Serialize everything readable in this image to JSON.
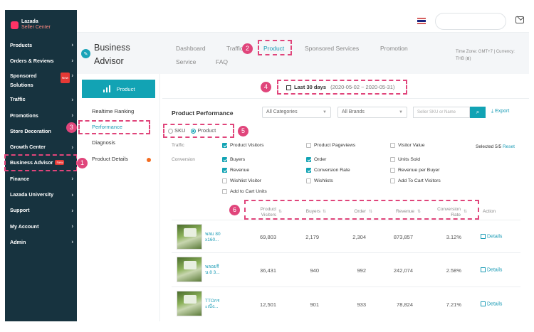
{
  "app": {
    "logo_line1": "Lazada",
    "logo_line2": "Seller Center"
  },
  "sidebar": {
    "items": [
      {
        "label": "Products"
      },
      {
        "label": "Orders & Reviews"
      },
      {
        "label": "Sponsored Solutions",
        "badge": "New"
      },
      {
        "label": "Traffic"
      },
      {
        "label": "Promotions"
      },
      {
        "label": "Store Decoration"
      },
      {
        "label": "Growth Center"
      },
      {
        "label": "Business Advisor",
        "badge": "New"
      },
      {
        "label": "Finance"
      },
      {
        "label": "Lazada University"
      },
      {
        "label": "Support"
      },
      {
        "label": "My Account"
      },
      {
        "label": "Admin"
      }
    ]
  },
  "header": {
    "title_line1": "Business",
    "title_line2": "Advisor",
    "tabs": [
      "Dashboard",
      "Traffic",
      "Product",
      "Sponsored Services",
      "Promotion",
      "Service",
      "FAQ"
    ],
    "timezone": "Time Zone: GMT+7 | Currency:",
    "currency": "THB (฿)"
  },
  "subnav": {
    "button": "Product",
    "items": [
      "Realtime Ranking",
      "Performance",
      "Diagnosis",
      "Product Details"
    ]
  },
  "datebar": {
    "range_label": "Last 30 days",
    "range": "(2020-05-02 ~ 2020-05-31)"
  },
  "main": {
    "title": "Product Performance",
    "category_select": "All Categories",
    "brand_select": "All Brands",
    "search_placeholder": "Seller SKU or Name",
    "export": "Export",
    "radio_sku": "SKU",
    "radio_product": "Product",
    "traffic_label": "Traffic",
    "conversion_label": "Conversion",
    "selected": "Selected 5/5",
    "reset": "Reset",
    "metrics": {
      "product_visitors": "Product Visitors",
      "product_pageviews": "Product Pageviews",
      "visitor_value": "Visitor Value",
      "buyers": "Buyers",
      "order": "Order",
      "units_sold": "Units Sold",
      "revenue": "Revenue",
      "conversion_rate": "Conversion Rate",
      "revenue_per_buyer": "Revenue per Buyer",
      "wishlist_visitor": "Wishlist Visitor",
      "wishlists": "Wishlists",
      "add_to_cart_visitors": "Add To Cart Visitors",
      "add_to_cart_units": "Add to Cart Units"
    },
    "columns": {
      "visitors_l1": "Product",
      "visitors_l2": "Visitors",
      "buyers": "Buyers",
      "order": "Order",
      "revenue": "Revenue",
      "conv_l1": "Conversion",
      "conv_l2": "Rate",
      "action": "Action"
    },
    "rows": [
      {
        "name_l1": "พลม 80",
        "name_l2": "x160...",
        "visitors": "69,803",
        "buyers": "2,179",
        "order": "2,304",
        "revenue": "873,857",
        "conv": "3.12%",
        "action": "Details"
      },
      {
        "name_l1": "พลอยรี",
        "name_l2": "น 8 3...",
        "visitors": "36,431",
        "buyers": "940",
        "order": "992",
        "revenue": "242,074",
        "conv": "2.58%",
        "action": "Details"
      },
      {
        "name_l1": "TTOกร",
        "name_l2": "ะเบีง...",
        "visitors": "12,501",
        "buyers": "901",
        "order": "933",
        "revenue": "78,824",
        "conv": "7.21%",
        "action": "Details"
      }
    ]
  },
  "annotations": [
    "1",
    "2",
    "3",
    "4",
    "5",
    "6"
  ],
  "colors": {
    "sidebar": "#17333f",
    "accent": "#12a3b4",
    "annotation": "#e0457b"
  }
}
